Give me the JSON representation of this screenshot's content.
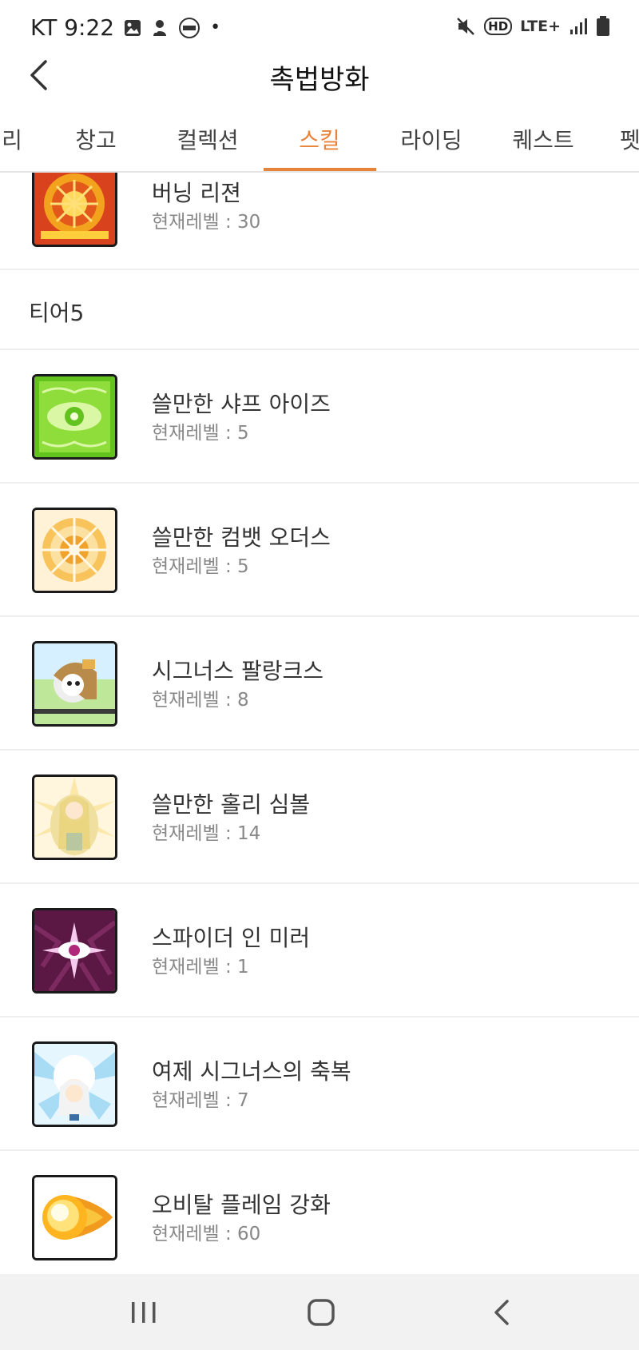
{
  "status_bar": {
    "carrier_time": "KT 9:22",
    "dot": "•",
    "network": "LTE+",
    "hd": "HD",
    "icons": [
      "image-icon",
      "app-icon",
      "dashin-icon",
      "mute-icon",
      "hd-icon",
      "lte-icon",
      "signal-icon",
      "battery-icon"
    ]
  },
  "header": {
    "title": "촉법방화",
    "back_icon": "chevron-left-icon"
  },
  "tabs": [
    {
      "label": "리"
    },
    {
      "label": "창고"
    },
    {
      "label": "컬렉션"
    },
    {
      "label": "스킬",
      "active": true
    },
    {
      "label": "라이딩"
    },
    {
      "label": "퀘스트"
    },
    {
      "label": "펫"
    }
  ],
  "accent_color": "#e8833a",
  "level_prefix": "현재레벨 : ",
  "list": {
    "top_skill": {
      "name": "버닝 리젼",
      "level": "현재레벨 : 30",
      "icon": "burning-region-icon"
    },
    "tier_label": "티어5",
    "skills": [
      {
        "name": "쓸만한 샤프 아이즈",
        "level": "현재레벨 : 5",
        "icon": "sharp-eyes-icon"
      },
      {
        "name": "쓸만한 컴뱃 오더스",
        "level": "현재레벨 : 5",
        "icon": "combat-orders-icon"
      },
      {
        "name": "시그너스 팔랑크스",
        "level": "현재레벨 : 8",
        "icon": "cygnus-phalanx-icon"
      },
      {
        "name": "쓸만한 홀리 심볼",
        "level": "현재레벨 : 14",
        "icon": "holy-symbol-icon"
      },
      {
        "name": "스파이더 인 미러",
        "level": "현재레벨 : 1",
        "icon": "spider-in-mirror-icon"
      },
      {
        "name": "여제 시그너스의 축복",
        "level": "현재레벨 : 7",
        "icon": "empress-blessing-icon"
      },
      {
        "name": "오비탈 플레임 강화",
        "level": "현재레벨 : 60",
        "icon": "orbital-flame-icon"
      }
    ]
  },
  "navbar": {
    "recent_icon": "recent-apps-icon",
    "home_icon": "home-icon",
    "back_icon": "back-icon"
  }
}
